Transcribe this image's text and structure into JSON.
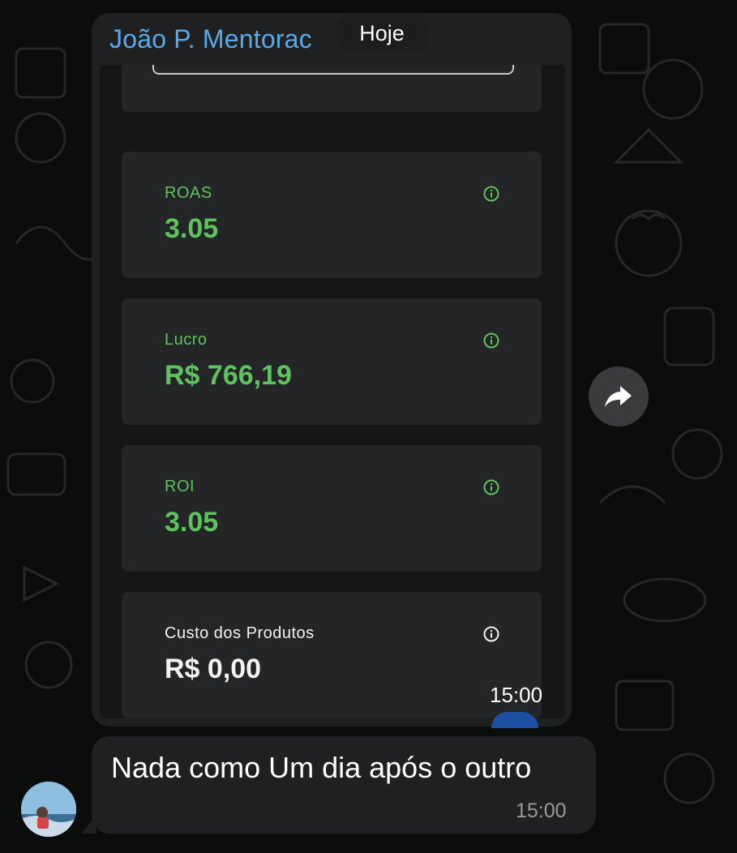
{
  "chat": {
    "sender_name": "João P. Mentorac",
    "date_label": "Hoje",
    "forward_icon": "forward-arrow-icon",
    "info_icon": "info-circle-icon"
  },
  "metrics": [
    {
      "label": "ROAS",
      "value": "3.05",
      "color": "#5fc25f"
    },
    {
      "label": "Lucro",
      "value": "R$ 766,19",
      "color": "#5fc25f"
    },
    {
      "label": "ROI",
      "value": "3.05",
      "color": "#5fc25f"
    },
    {
      "label": "Custo dos Produtos",
      "value": "R$ 0,00",
      "color": "#f2f2f2"
    }
  ],
  "image_message": {
    "time": "15:00"
  },
  "reply_message": {
    "text": "Nada como Um dia após o outro",
    "time": "15:00"
  },
  "colors": {
    "accent_blue": "#5aa9ea",
    "bubble_bg": "#1f2021",
    "card_bg": "#242526",
    "positive_green": "#5fc25f"
  }
}
